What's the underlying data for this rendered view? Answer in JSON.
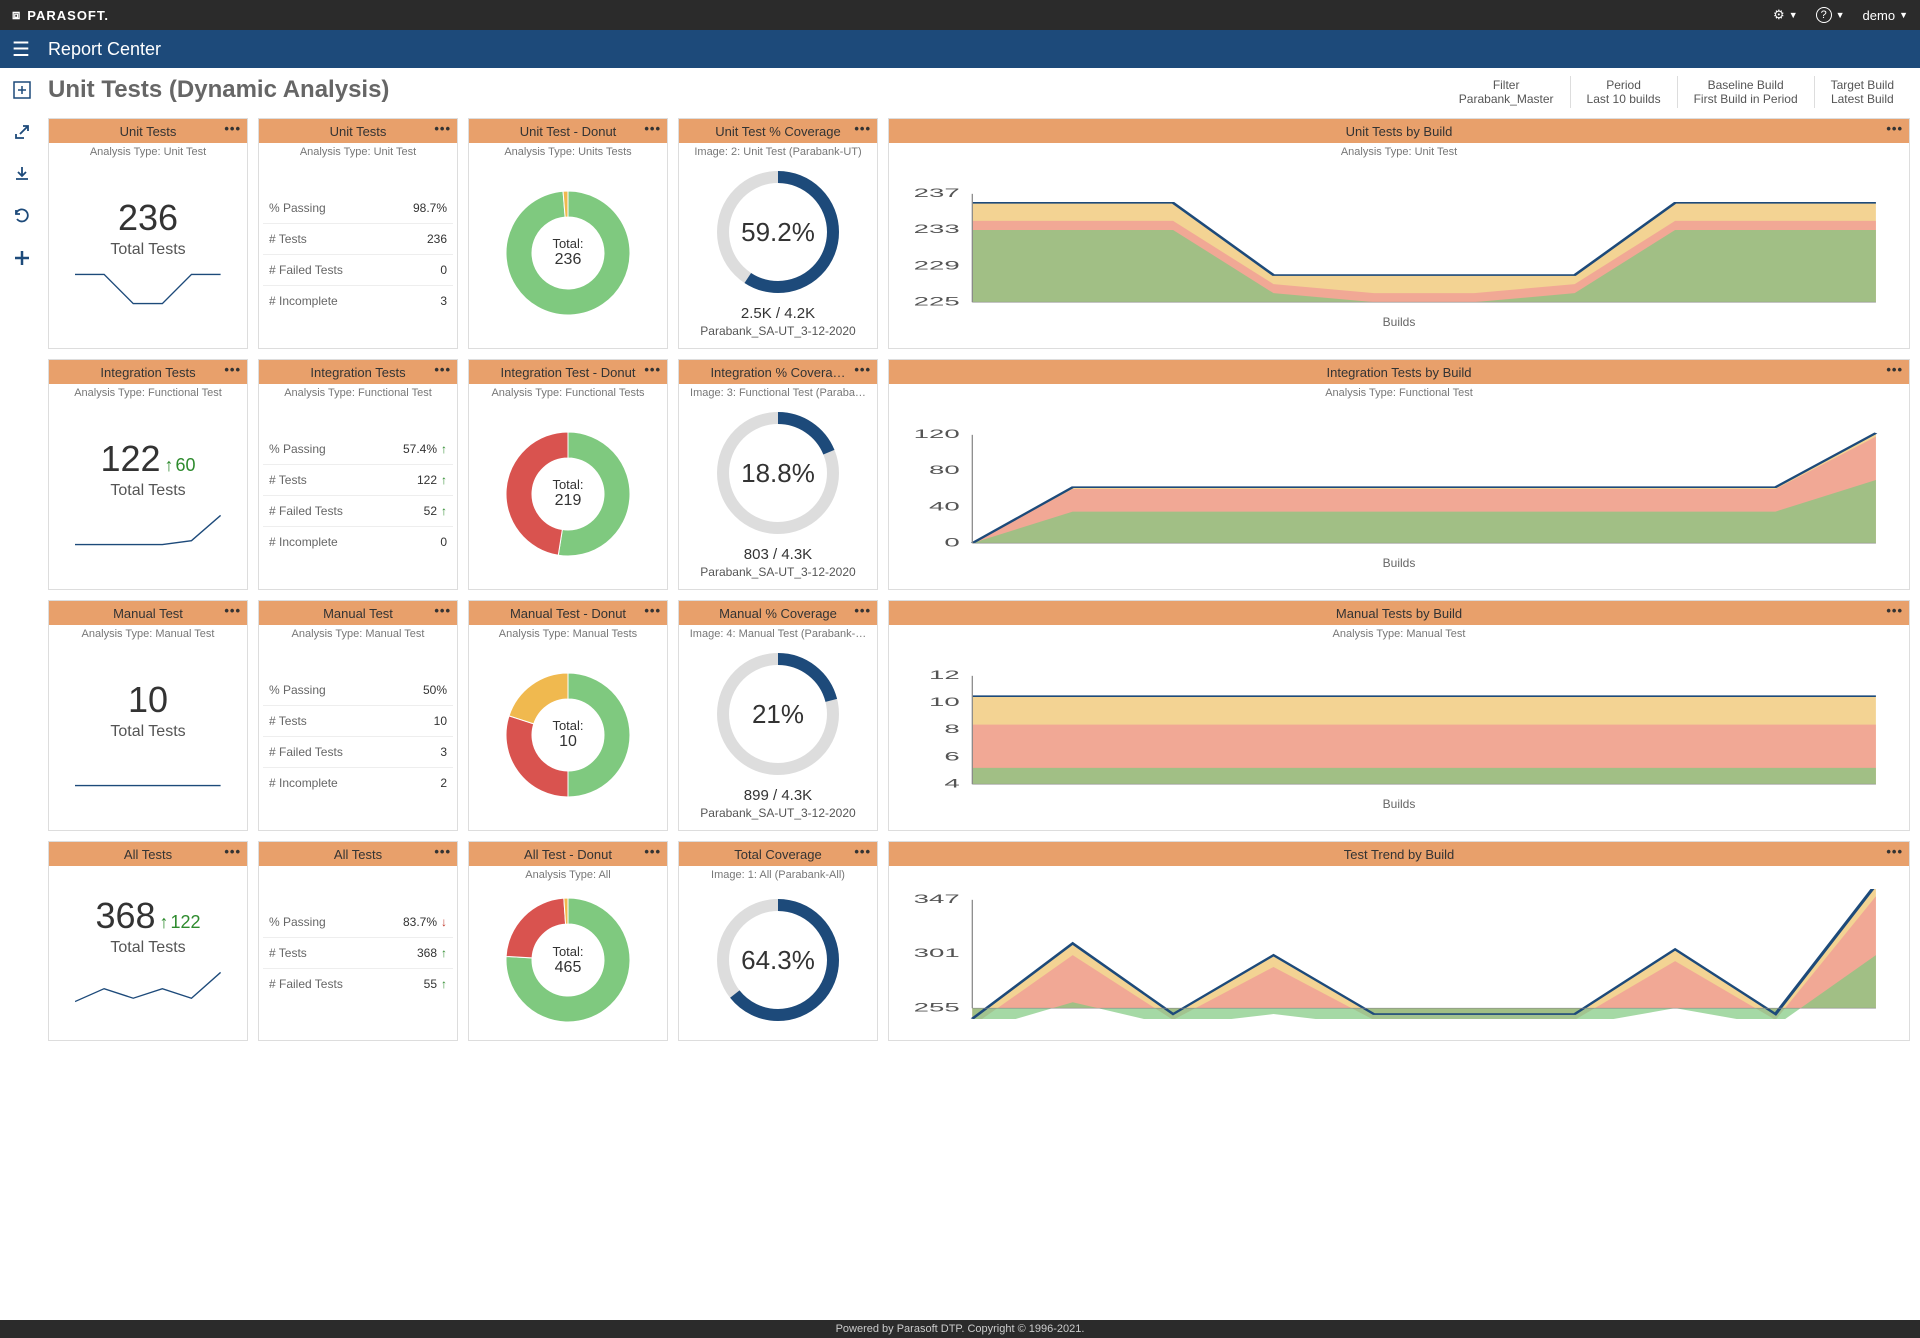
{
  "brand": "PARASOFT.",
  "topbar": {
    "user": "demo"
  },
  "bluebar": {
    "title": "Report Center"
  },
  "page": {
    "title": "Unit Tests (Dynamic Analysis)"
  },
  "filters": [
    {
      "label": "Filter",
      "value": "Parabank_Master"
    },
    {
      "label": "Period",
      "value": "Last 10 builds"
    },
    {
      "label": "Baseline Build",
      "value": "First Build in Period"
    },
    {
      "label": "Target Build",
      "value": "Latest Build"
    }
  ],
  "footer": "Powered by Parasoft DTP. Copyright © 1996-2021.",
  "rows": [
    {
      "summary": {
        "title": "Unit Tests",
        "subtitle": "Analysis Type: Unit Test",
        "value": "236",
        "delta": "",
        "delta_dir": "",
        "label": "Total Tests",
        "spark": [
          236,
          236,
          228,
          228,
          236,
          236
        ]
      },
      "stats": {
        "title": "Unit Tests",
        "subtitle": "Analysis Type: Unit Test",
        "rows": [
          {
            "k": "% Passing",
            "v": "98.7%",
            "dir": ""
          },
          {
            "k": "# Tests",
            "v": "236",
            "dir": ""
          },
          {
            "k": "# Failed Tests",
            "v": "0",
            "dir": ""
          },
          {
            "k": "# Incomplete",
            "v": "3",
            "dir": ""
          }
        ]
      },
      "donut": {
        "title": "Unit Test - Donut",
        "subtitle": "Analysis Type: Units Tests",
        "center_label": "Total:",
        "center_value": "236",
        "slices": [
          {
            "color": "#7fc97f",
            "v": 233
          },
          {
            "color": "#f0b94f",
            "v": 3
          },
          {
            "color": "#d9534f",
            "v": 0
          }
        ]
      },
      "coverage": {
        "title": "Unit Test % Coverage",
        "subtitle": "Image: 2: Unit Test (Parabank-UT)",
        "pct": 59.2,
        "pct_text": "59.2%",
        "sub": "2.5K / 4.2K",
        "label": "Parabank_SA-UT_3-12-2020"
      },
      "bybuild": {
        "title": "Unit Tests by Build",
        "subtitle": "Analysis Type: Unit Test",
        "xlabel": "Builds",
        "yticks": [
          225,
          229,
          233,
          237
        ],
        "series_top": [
          236,
          236,
          236,
          228,
          228,
          228,
          228,
          236,
          236,
          236
        ],
        "series_mid": [
          234,
          234,
          234,
          227,
          226,
          226,
          227,
          234,
          234,
          234
        ],
        "series_low": [
          233,
          233,
          233,
          226,
          225,
          225,
          226,
          233,
          233,
          233
        ]
      }
    },
    {
      "summary": {
        "title": "Integration Tests",
        "subtitle": "Analysis Type: Functional Test",
        "value": "122",
        "delta": "60",
        "delta_dir": "up",
        "label": "Total Tests",
        "spark": [
          62,
          62,
          62,
          62,
          70,
          122
        ]
      },
      "stats": {
        "title": "Integration Tests",
        "subtitle": "Analysis Type: Functional Test",
        "rows": [
          {
            "k": "% Passing",
            "v": "57.4%",
            "dir": "up"
          },
          {
            "k": "# Tests",
            "v": "122",
            "dir": "up"
          },
          {
            "k": "# Failed Tests",
            "v": "52",
            "dir": "up"
          },
          {
            "k": "# Incomplete",
            "v": "0",
            "dir": ""
          }
        ]
      },
      "donut": {
        "title": "Integration Test - Donut",
        "subtitle": "Analysis Type: Functional Tests",
        "center_label": "Total:",
        "center_value": "219",
        "slices": [
          {
            "color": "#7fc97f",
            "v": 115
          },
          {
            "color": "#d9534f",
            "v": 104
          },
          {
            "color": "#f0b94f",
            "v": 0
          }
        ]
      },
      "coverage": {
        "title": "Integration % Covera…",
        "subtitle": "Image: 3: Functional Test (Paraba…",
        "pct": 18.8,
        "pct_text": "18.8%",
        "sub": "803 / 4.3K",
        "label": "Parabank_SA-UT_3-12-2020"
      },
      "bybuild": {
        "title": "Integration Tests by Build",
        "subtitle": "Analysis Type: Functional Test",
        "xlabel": "Builds",
        "yticks": [
          0,
          40,
          80,
          120
        ],
        "series_top": [
          0,
          62,
          62,
          62,
          62,
          62,
          62,
          62,
          62,
          122
        ],
        "series_mid": [
          0,
          60,
          60,
          60,
          60,
          60,
          60,
          60,
          60,
          118
        ],
        "series_low": [
          0,
          35,
          35,
          35,
          35,
          35,
          35,
          35,
          35,
          70
        ]
      }
    },
    {
      "summary": {
        "title": "Manual Test",
        "subtitle": "Analysis Type: Manual Test",
        "value": "10",
        "delta": "",
        "delta_dir": "",
        "label": "Total Tests",
        "spark": [
          10,
          10,
          10,
          10,
          10,
          10
        ]
      },
      "stats": {
        "title": "Manual Test",
        "subtitle": "Analysis Type: Manual Test",
        "rows": [
          {
            "k": "% Passing",
            "v": "50%",
            "dir": ""
          },
          {
            "k": "# Tests",
            "v": "10",
            "dir": ""
          },
          {
            "k": "# Failed Tests",
            "v": "3",
            "dir": ""
          },
          {
            "k": "# Incomplete",
            "v": "2",
            "dir": ""
          }
        ]
      },
      "donut": {
        "title": "Manual Test - Donut",
        "subtitle": "Analysis Type: Manual Tests",
        "center_label": "Total:",
        "center_value": "10",
        "slices": [
          {
            "color": "#7fc97f",
            "v": 5
          },
          {
            "color": "#d9534f",
            "v": 3
          },
          {
            "color": "#f0b94f",
            "v": 2
          }
        ]
      },
      "coverage": {
        "title": "Manual % Coverage",
        "subtitle": "Image: 4: Manual Test (Parabank-…",
        "pct": 21,
        "pct_text": "21%",
        "sub": "899 / 4.3K",
        "label": "Parabank_SA-UT_3-12-2020"
      },
      "bybuild": {
        "title": "Manual Tests by Build",
        "subtitle": "Analysis Type: Manual Test",
        "xlabel": "Builds",
        "yticks": [
          4,
          6,
          8,
          10,
          12
        ],
        "series_top": [
          10.5,
          10.5,
          10.5,
          10.5,
          10.5,
          10.5,
          10.5,
          10.5,
          10.5,
          10.5
        ],
        "series_mid": [
          8.4,
          8.4,
          8.4,
          8.4,
          8.4,
          8.4,
          8.4,
          8.4,
          8.4,
          8.4
        ],
        "series_low": [
          5.2,
          5.2,
          5.2,
          5.2,
          5.2,
          5.2,
          5.2,
          5.2,
          5.2,
          5.2
        ]
      }
    },
    {
      "summary": {
        "title": "All Tests",
        "subtitle": "",
        "value": "368",
        "delta": "122",
        "delta_dir": "up",
        "label": "Total Tests",
        "spark": [
          246,
          300,
          260,
          300,
          260,
          368
        ]
      },
      "stats": {
        "title": "All Tests",
        "subtitle": "",
        "rows": [
          {
            "k": "% Passing",
            "v": "83.7%",
            "dir": "down"
          },
          {
            "k": "# Tests",
            "v": "368",
            "dir": "up"
          },
          {
            "k": "# Failed Tests",
            "v": "55",
            "dir": "up"
          }
        ]
      },
      "donut": {
        "title": "All Test - Donut",
        "subtitle": "Analysis Type: All",
        "center_label": "Total:",
        "center_value": "465",
        "slices": [
          {
            "color": "#7fc97f",
            "v": 353
          },
          {
            "color": "#d9534f",
            "v": 107
          },
          {
            "color": "#f0b94f",
            "v": 5
          }
        ]
      },
      "coverage": {
        "title": "Total Coverage",
        "subtitle": "Image: 1: All (Parabank-All)",
        "pct": 64.3,
        "pct_text": "64.3%",
        "sub": "",
        "label": ""
      },
      "bybuild": {
        "title": "Test Trend by Build",
        "subtitle": "",
        "xlabel": "",
        "yticks": [
          255,
          301,
          347
        ],
        "series_top": [
          246,
          310,
          250,
          300,
          250,
          250,
          250,
          305,
          250,
          360
        ],
        "series_mid": [
          240,
          300,
          245,
          290,
          245,
          245,
          245,
          295,
          245,
          350
        ],
        "series_low": [
          235,
          260,
          240,
          250,
          240,
          240,
          240,
          255,
          240,
          300
        ]
      }
    }
  ],
  "chart_data": [
    {
      "type": "area",
      "title": "Unit Tests by Build",
      "xlabel": "Builds",
      "ylim": [
        225,
        237
      ],
      "series": [
        {
          "name": "total",
          "values": [
            236,
            236,
            236,
            228,
            228,
            228,
            228,
            236,
            236,
            236
          ]
        },
        {
          "name": "mid",
          "values": [
            234,
            234,
            234,
            227,
            226,
            226,
            227,
            234,
            234,
            234
          ]
        },
        {
          "name": "pass",
          "values": [
            233,
            233,
            233,
            226,
            225,
            225,
            226,
            233,
            233,
            233
          ]
        }
      ]
    },
    {
      "type": "area",
      "title": "Integration Tests by Build",
      "xlabel": "Builds",
      "ylim": [
        0,
        120
      ],
      "series": [
        {
          "name": "total",
          "values": [
            0,
            62,
            62,
            62,
            62,
            62,
            62,
            62,
            62,
            122
          ]
        },
        {
          "name": "mid",
          "values": [
            0,
            60,
            60,
            60,
            60,
            60,
            60,
            60,
            60,
            118
          ]
        },
        {
          "name": "pass",
          "values": [
            0,
            35,
            35,
            35,
            35,
            35,
            35,
            35,
            35,
            70
          ]
        }
      ]
    },
    {
      "type": "area",
      "title": "Manual Tests by Build",
      "xlabel": "Builds",
      "ylim": [
        4,
        12
      ],
      "series": [
        {
          "name": "total",
          "values": [
            10.5,
            10.5,
            10.5,
            10.5,
            10.5,
            10.5,
            10.5,
            10.5,
            10.5,
            10.5
          ]
        },
        {
          "name": "mid",
          "values": [
            8.4,
            8.4,
            8.4,
            8.4,
            8.4,
            8.4,
            8.4,
            8.4,
            8.4,
            8.4
          ]
        },
        {
          "name": "pass",
          "values": [
            5.2,
            5.2,
            5.2,
            5.2,
            5.2,
            5.2,
            5.2,
            5.2,
            5.2,
            5.2
          ]
        }
      ]
    },
    {
      "type": "area",
      "title": "Test Trend by Build",
      "xlabel": "",
      "ylim": [
        209,
        393
      ],
      "series": [
        {
          "name": "total",
          "values": [
            246,
            310,
            250,
            300,
            250,
            250,
            250,
            305,
            250,
            360
          ]
        },
        {
          "name": "mid",
          "values": [
            240,
            300,
            245,
            290,
            245,
            245,
            245,
            295,
            245,
            350
          ]
        },
        {
          "name": "pass",
          "values": [
            235,
            260,
            240,
            250,
            240,
            240,
            240,
            255,
            240,
            300
          ]
        }
      ]
    },
    {
      "type": "pie",
      "title": "Unit Test - Donut",
      "values": {
        "pass": 233,
        "incomplete": 3,
        "fail": 0
      },
      "total": 236
    },
    {
      "type": "pie",
      "title": "Integration Test - Donut",
      "values": {
        "pass": 115,
        "fail": 104,
        "incomplete": 0
      },
      "total": 219
    },
    {
      "type": "pie",
      "title": "Manual Test - Donut",
      "values": {
        "pass": 5,
        "fail": 3,
        "incomplete": 2
      },
      "total": 10
    },
    {
      "type": "pie",
      "title": "All Test - Donut",
      "values": {
        "pass": 353,
        "fail": 107,
        "incomplete": 5
      },
      "total": 465
    }
  ]
}
